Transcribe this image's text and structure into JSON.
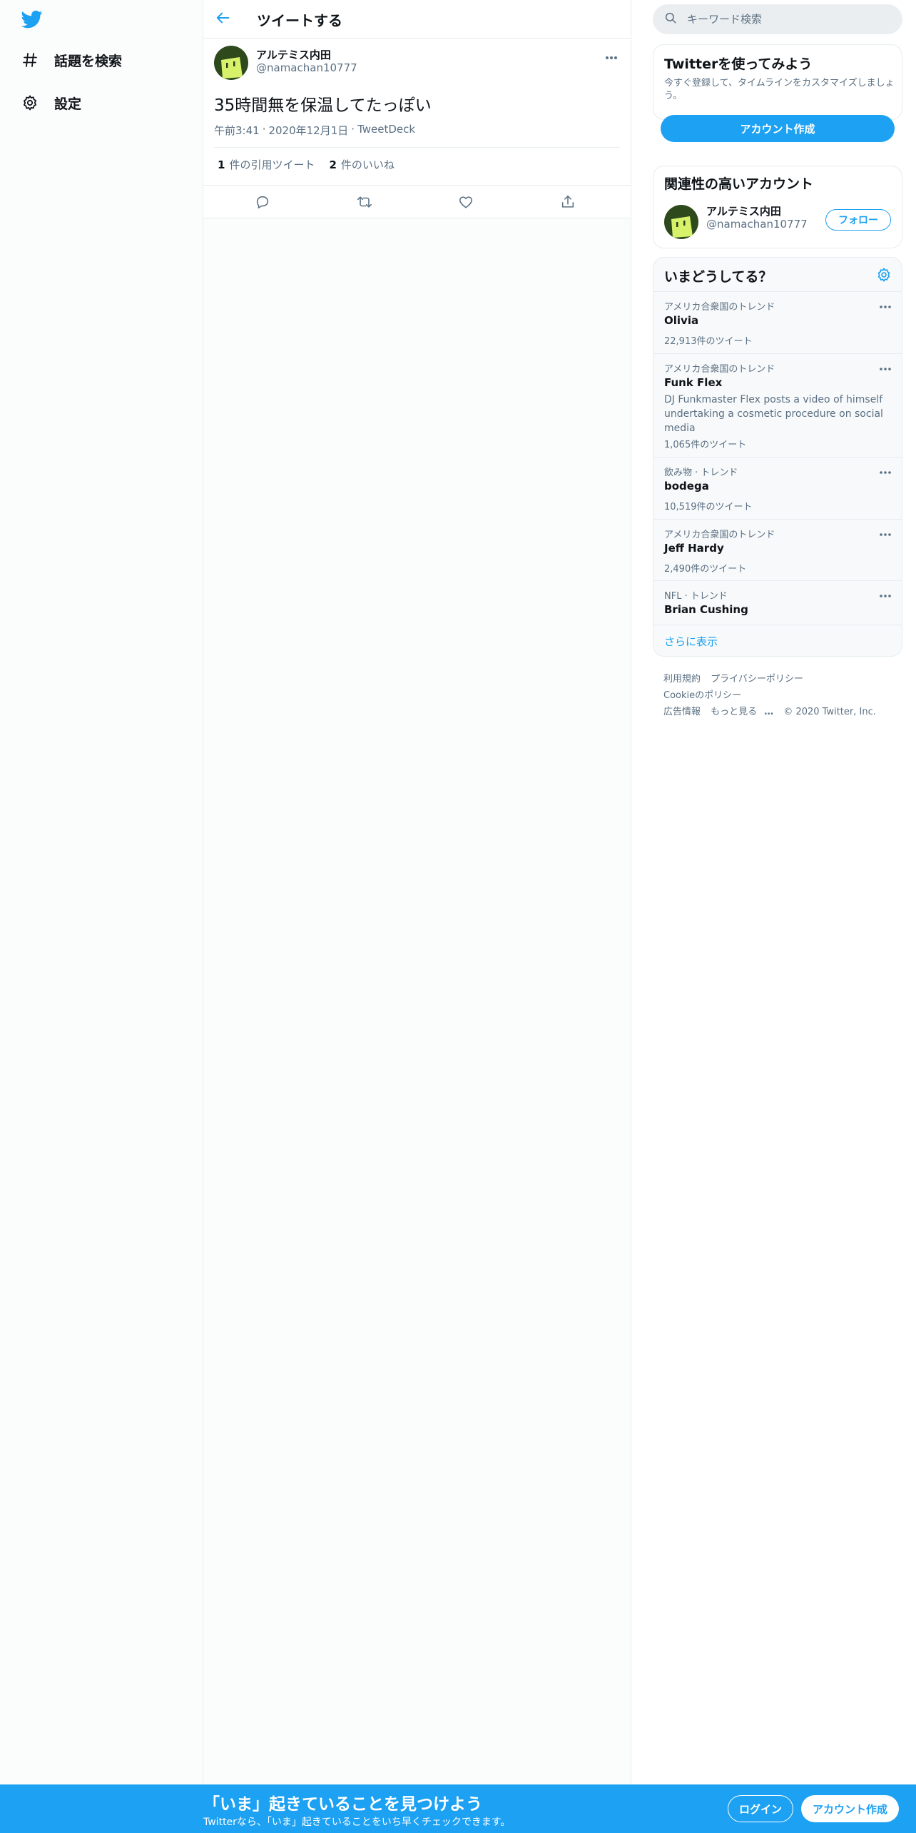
{
  "leftnav": {
    "logo_icon": "twitter-bird-icon",
    "items": [
      {
        "icon": "hashtag-icon",
        "label": "話題を検索"
      },
      {
        "icon": "gear-icon",
        "label": "設定"
      }
    ]
  },
  "header": {
    "back_icon": "arrow-left-icon",
    "title": "ツイートする"
  },
  "tweet": {
    "author_name": "アルテミス内田",
    "author_handle": "@namachan10777",
    "text": "35時間無を保温してたっぽい",
    "time": "午前3:41",
    "date": "2020年12月1日",
    "source": "TweetDeck",
    "separator": "·",
    "quote_count": "1",
    "quote_label": "件の引用ツイート",
    "like_count": "2",
    "like_label": "件のいいね",
    "actions": [
      "reply-icon",
      "retweet-icon",
      "like-icon",
      "share-icon"
    ]
  },
  "search": {
    "placeholder": "キーワード検索",
    "icon": "search-icon"
  },
  "signup_card": {
    "title": "Twitterを使ってみよう",
    "description": "今すぐ登録して、タイムラインをカスタマイズしましょう。",
    "button": "アカウント作成"
  },
  "related": {
    "title": "関連性の高いアカウント",
    "name": "アルテミス内田",
    "handle": "@namachan10777",
    "follow_button": "フォロー"
  },
  "trends": {
    "title": "いまどうしてる？",
    "items": [
      {
        "category": "アメリカ合衆国のトレンド",
        "name": "Olivia",
        "description": "",
        "count": "22,913件のツイート"
      },
      {
        "category": "アメリカ合衆国のトレンド",
        "name": "Funk Flex",
        "description": "DJ Funkmaster Flex posts a video of himself undertaking a cosmetic procedure on social media",
        "count": "1,065件のツイート"
      },
      {
        "category": "飲み物 · トレンド",
        "name": "bodega",
        "description": "",
        "count": "10,519件のツイート"
      },
      {
        "category": "アメリカ合衆国のトレンド",
        "name": "Jeff Hardy",
        "description": "",
        "count": "2,490件のツイート"
      },
      {
        "category": "NFL · トレンド",
        "name": "Brian Cushing",
        "description": "",
        "count": ""
      }
    ],
    "show_more": "さらに表示"
  },
  "footer": {
    "links": [
      "利用規約",
      "プライバシーポリシー",
      "Cookieのポリシー",
      "広告情報",
      "もっと見る"
    ],
    "more_suffix": "…",
    "copyright": "© 2020 Twitter, Inc."
  },
  "bottom_bar": {
    "title": "「いま」起きていることを見つけよう",
    "subtitle": "Twitterなら、「いま」起きていることをいち早くチェックできます。",
    "login": "ログイン",
    "signup": "アカウント作成"
  },
  "colors": {
    "accent": "#1da1f2",
    "secondary_text": "#5b7083",
    "border": "#e6ecf0"
  }
}
